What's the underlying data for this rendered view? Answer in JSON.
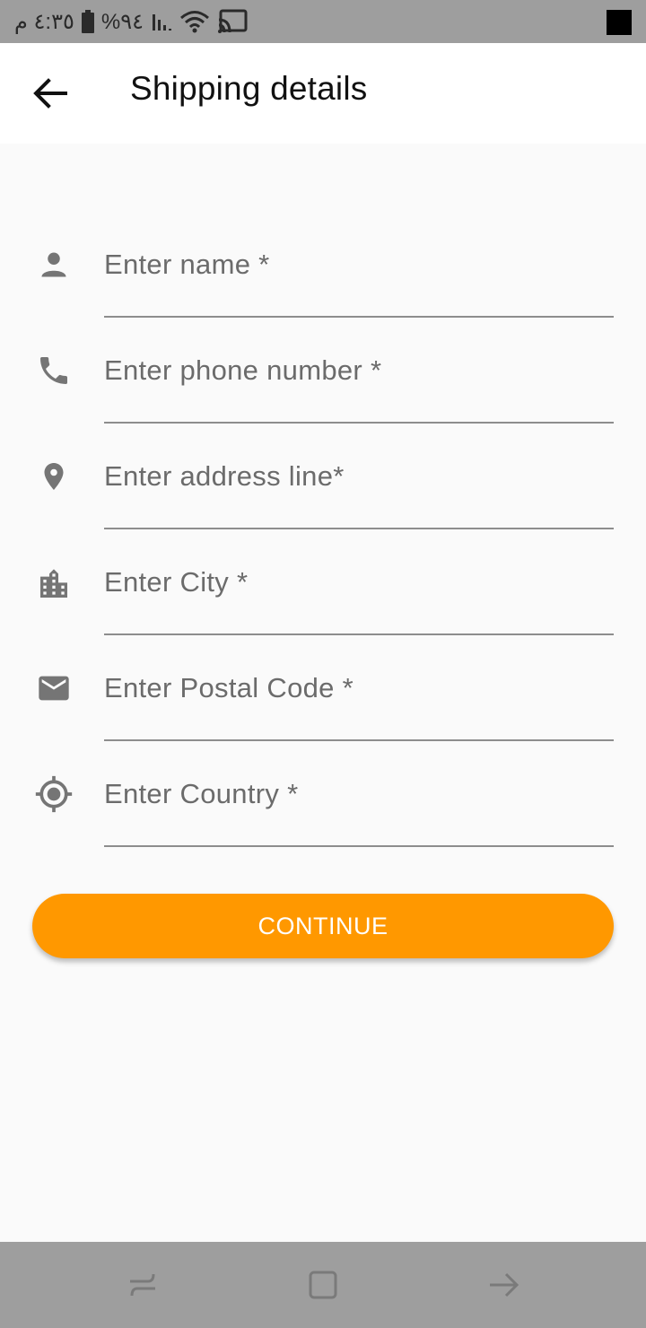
{
  "status_bar": {
    "time": "٤:٣٥ م",
    "battery": "%٩٤"
  },
  "header": {
    "title": "Shipping details"
  },
  "form": {
    "fields": [
      {
        "icon": "person-icon",
        "placeholder": "Enter name *",
        "value": ""
      },
      {
        "icon": "phone-icon",
        "placeholder": "Enter phone number *",
        "value": ""
      },
      {
        "icon": "location-pin-icon",
        "placeholder": "Enter address line*",
        "value": ""
      },
      {
        "icon": "city-icon",
        "placeholder": "Enter City *",
        "value": ""
      },
      {
        "icon": "mail-icon",
        "placeholder": "Enter Postal Code *",
        "value": ""
      },
      {
        "icon": "gps-target-icon",
        "placeholder": "Enter Country *",
        "value": ""
      }
    ],
    "continue_label": "CONTINUE"
  },
  "colors": {
    "accent": "#ff9800",
    "icon": "#757575",
    "bars": "#9e9e9e"
  }
}
